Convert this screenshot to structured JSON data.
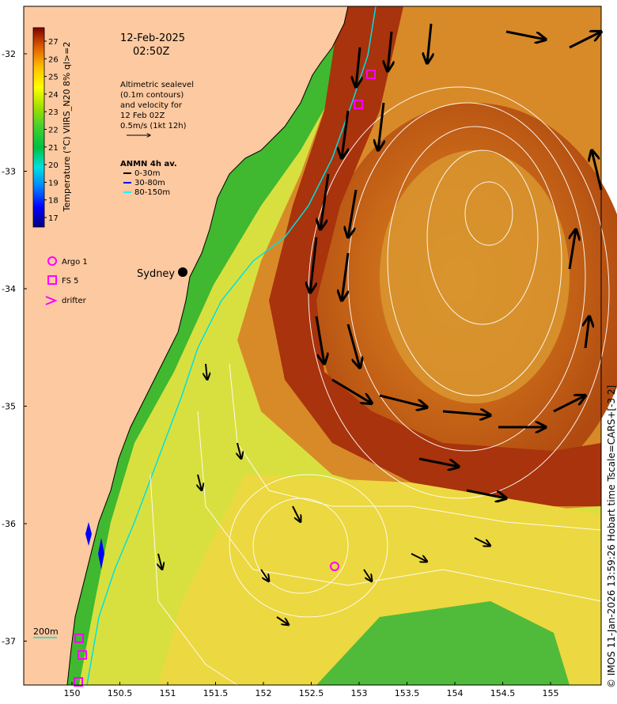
{
  "date_label": "12-Feb-2025",
  "time_label": "02:50Z",
  "altimetry_note": [
    "Altimetric sealevel",
    "(0.1m contours)",
    "and velocity for",
    "12 Feb 02Z",
    "0.5m/s (1kt 12h)"
  ],
  "anmn": {
    "title": "ANMN 4h av.",
    "items": [
      "0-30m",
      "30-80m",
      "80-150m"
    ],
    "colors": [
      "#000000",
      "#0000ff",
      "#00ffff"
    ]
  },
  "legend_items": [
    "Argo 1",
    "FS 5",
    "drifter"
  ],
  "marker_color": "#ff00ff",
  "city": "Sydney",
  "depth_label": "200m",
  "colorbar": {
    "label": "Temperature (°C) VIIRS_N20 8% ql>=2",
    "ticks": [
      "27",
      "26",
      "25",
      "24",
      "23",
      "22",
      "21",
      "20",
      "19",
      "18",
      "17"
    ],
    "colors": [
      "#00007f",
      "#0000ff",
      "#0080ff",
      "#00e0e0",
      "#00c040",
      "#30c030",
      "#a0e000",
      "#ffff00",
      "#ffc000",
      "#ff8000",
      "#d04000",
      "#800000"
    ]
  },
  "x_ticks": [
    "150",
    "150.5",
    "151",
    "151.5",
    "152",
    "152.5",
    "153",
    "153.5",
    "154",
    "154.5",
    "155"
  ],
  "y_ticks": [
    "-32",
    "-33",
    "-34",
    "-35",
    "-36",
    "-37"
  ],
  "credit": "© IMOS 11-Jan-2026 13:59:26 Hobart time Tscale=CARS+[-3 2]",
  "colors": {
    "land": "#fdc9a0",
    "warm_core": "#a83a10",
    "shelf": "#e0e840"
  }
}
